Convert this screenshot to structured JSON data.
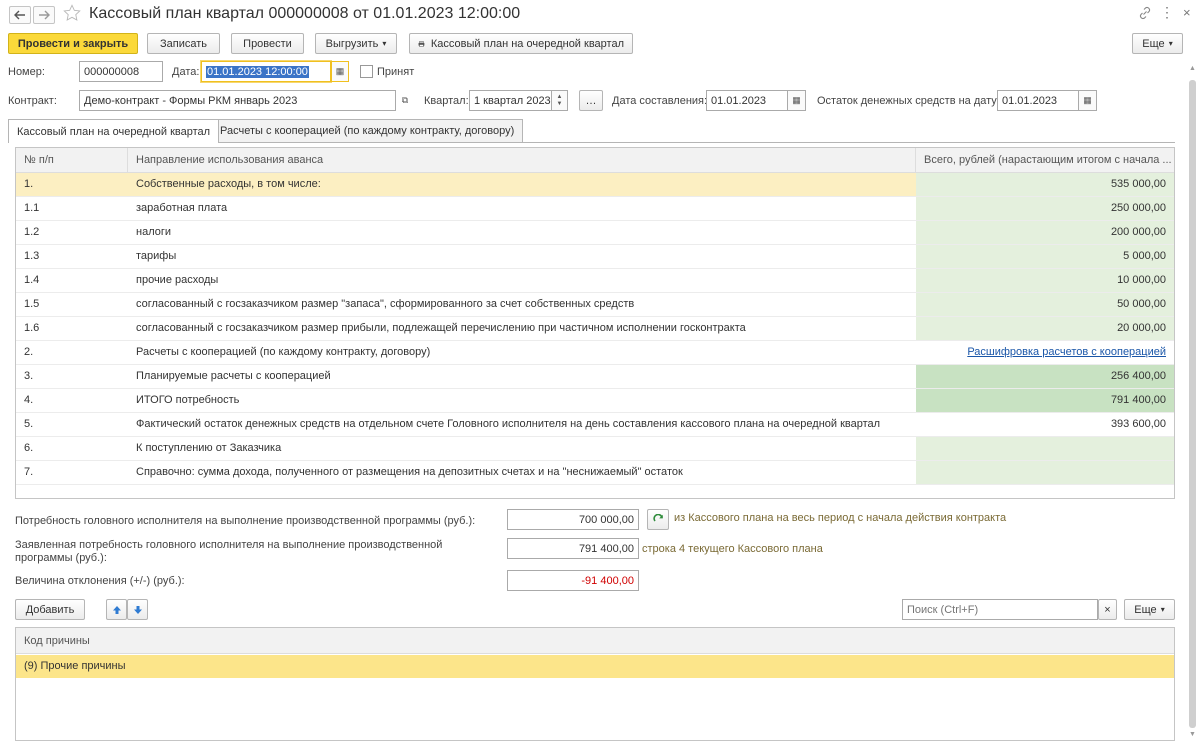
{
  "titlebar": {
    "title": "Кассовый план квартал 000000008 от 01.01.2023 12:00:00"
  },
  "toolbar": {
    "post_close": "Провести и закрыть",
    "save": "Записать",
    "post": "Провести",
    "export": "Выгрузить",
    "print": "Кассовый план на очередной квартал",
    "more": "Еще"
  },
  "header": {
    "number_label": "Номер:",
    "number_value": "000000008",
    "date_label": "Дата:",
    "date_value": "01.01.2023 12:00:00",
    "accepted_label": "Принят",
    "contract_label": "Контракт:",
    "contract_value": "Демо-контракт - Формы РКМ январь 2023",
    "quarter_label": "Квартал:",
    "quarter_value": "1 квартал 2023",
    "compose_date_label": "Дата составления:",
    "compose_date_value": "01.01.2023",
    "balance_date_label": "Остаток денежных средств на дату:",
    "balance_date_value": "01.01.2023"
  },
  "tabs": [
    {
      "label": "Кассовый план на очередной квартал"
    },
    {
      "label": "Расчеты с кооперацией (по каждому контракту, договору)"
    }
  ],
  "grid": {
    "columns": [
      "№ п/п",
      "Направление использования аванса",
      "Всего, рублей (нарастающим итогом с начала ..."
    ],
    "rows": [
      {
        "num": "1.",
        "name": "Собственные расходы, в том числе:",
        "total": "535 000,00"
      },
      {
        "num": "1.1",
        "name": "заработная плата",
        "total": "250 000,00"
      },
      {
        "num": "1.2",
        "name": "налоги",
        "total": "200 000,00"
      },
      {
        "num": "1.3",
        "name": "тарифы",
        "total": "5 000,00"
      },
      {
        "num": "1.4",
        "name": "прочие расходы",
        "total": "10 000,00"
      },
      {
        "num": "1.5",
        "name": "согласованный с госзаказчиком размер \"запаса\", сформированного за счет собственных средств",
        "total": "50 000,00"
      },
      {
        "num": "1.6",
        "name": "согласованный с госзаказчиком размер прибыли, подлежащей перечислению при частичном исполнении госконтракта",
        "total": "20 000,00"
      },
      {
        "num": "2.",
        "name": "Расчеты с кооперацией (по каждому контракту, договору)",
        "total": "Расшифровка расчетов с кооперацией"
      },
      {
        "num": "3.",
        "name": "Планируемые расчеты с кооперацией",
        "total": "256 400,00"
      },
      {
        "num": "4.",
        "name": "ИТОГО потребность",
        "total": "791 400,00"
      },
      {
        "num": "5.",
        "name": "Фактический остаток денежных средств на отдельном счете Головного исполнителя на день составления кассового плана на очередной квартал",
        "total": "393 600,00"
      },
      {
        "num": "6.",
        "name": "К поступлению от Заказчика",
        "total": ""
      },
      {
        "num": "7.",
        "name": "Справочно: сумма дохода, полученного от размещения на депозитных счетах и на \"неснижаемый\" остаток",
        "total": ""
      }
    ]
  },
  "summary": {
    "need_label": "Потребность головного исполнителя на выполнение производственной программы (руб.):",
    "need_value": "700 000,00",
    "need_note": "из Кассового плана на весь период с начала действия контракта",
    "declared_label": "Заявленная потребность головного исполнителя на выполнение производственной программы (руб.):",
    "declared_value": "791 400,00",
    "declared_note": "строка 4 текущего Кассового плана",
    "deviation_label": "Величина отклонения (+/-) (руб.):",
    "deviation_value": "-91 400,00"
  },
  "reasons": {
    "add": "Добавить",
    "search_placeholder": "Поиск (Ctrl+F)",
    "more": "Еще",
    "column": "Код причины",
    "rows": [
      "(9) Прочие причины"
    ]
  },
  "colors": {
    "accent_yellow": "#fbd93a",
    "selected_row": "#fcefc2",
    "light_green": "#e4f0dd",
    "medium_green": "#c8e2c2",
    "link_blue": "#1a56a8",
    "negative_red": "#d00000"
  }
}
